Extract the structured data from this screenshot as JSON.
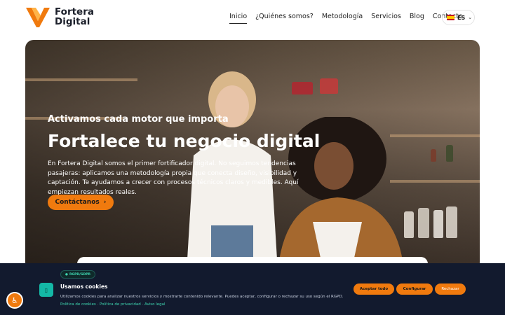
{
  "brand": {
    "line1": "Fortera",
    "line2": "Digital",
    "accent_color": "#f07a0e",
    "logo_icon": "v-shield-logo"
  },
  "nav": {
    "items": [
      {
        "label": "Inicio",
        "active": true
      },
      {
        "label": "¿Quiénes somos?",
        "active": false
      },
      {
        "label": "Metodología",
        "active": false
      },
      {
        "label": "Servicios",
        "active": false
      },
      {
        "label": "Blog",
        "active": false
      },
      {
        "label": "Contacto",
        "active": false
      }
    ],
    "language": {
      "code": "ES",
      "flag_icon": "spain-flag-icon"
    }
  },
  "hero": {
    "subtitle": "Activamos cada motor que importa",
    "title": "Fortalece tu negocio digital",
    "description": "En Fortera Digital somos el primer fortificador digital. No seguimos tendencias pasajeras: aplicamos una metodología propia que conecta diseño, visibilidad y captación. Te ayudamos a crecer con procesos técnicos claros y medibles. Aquí empiezan resultados reales.",
    "cta_label": "Contáctanos"
  },
  "cookie_banner": {
    "badge": "RGPD/GDPR",
    "title": "Usamos cookies",
    "text": "Utilizamos cookies para analizar nuestros servicios y mostrarte contenido relevante. Puedes aceptar, configurar o rechazar su uso según el RGPD.",
    "links": [
      "Política de cookies",
      "Política de privacidad",
      "Aviso legal"
    ],
    "link_separator": "·",
    "buttons": {
      "accept": "Aceptar todo",
      "configure": "Configurar",
      "reject": "Rechazar"
    },
    "icon": "cookie-shield-icon"
  },
  "accessibility": {
    "icon": "accessibility-icon"
  }
}
